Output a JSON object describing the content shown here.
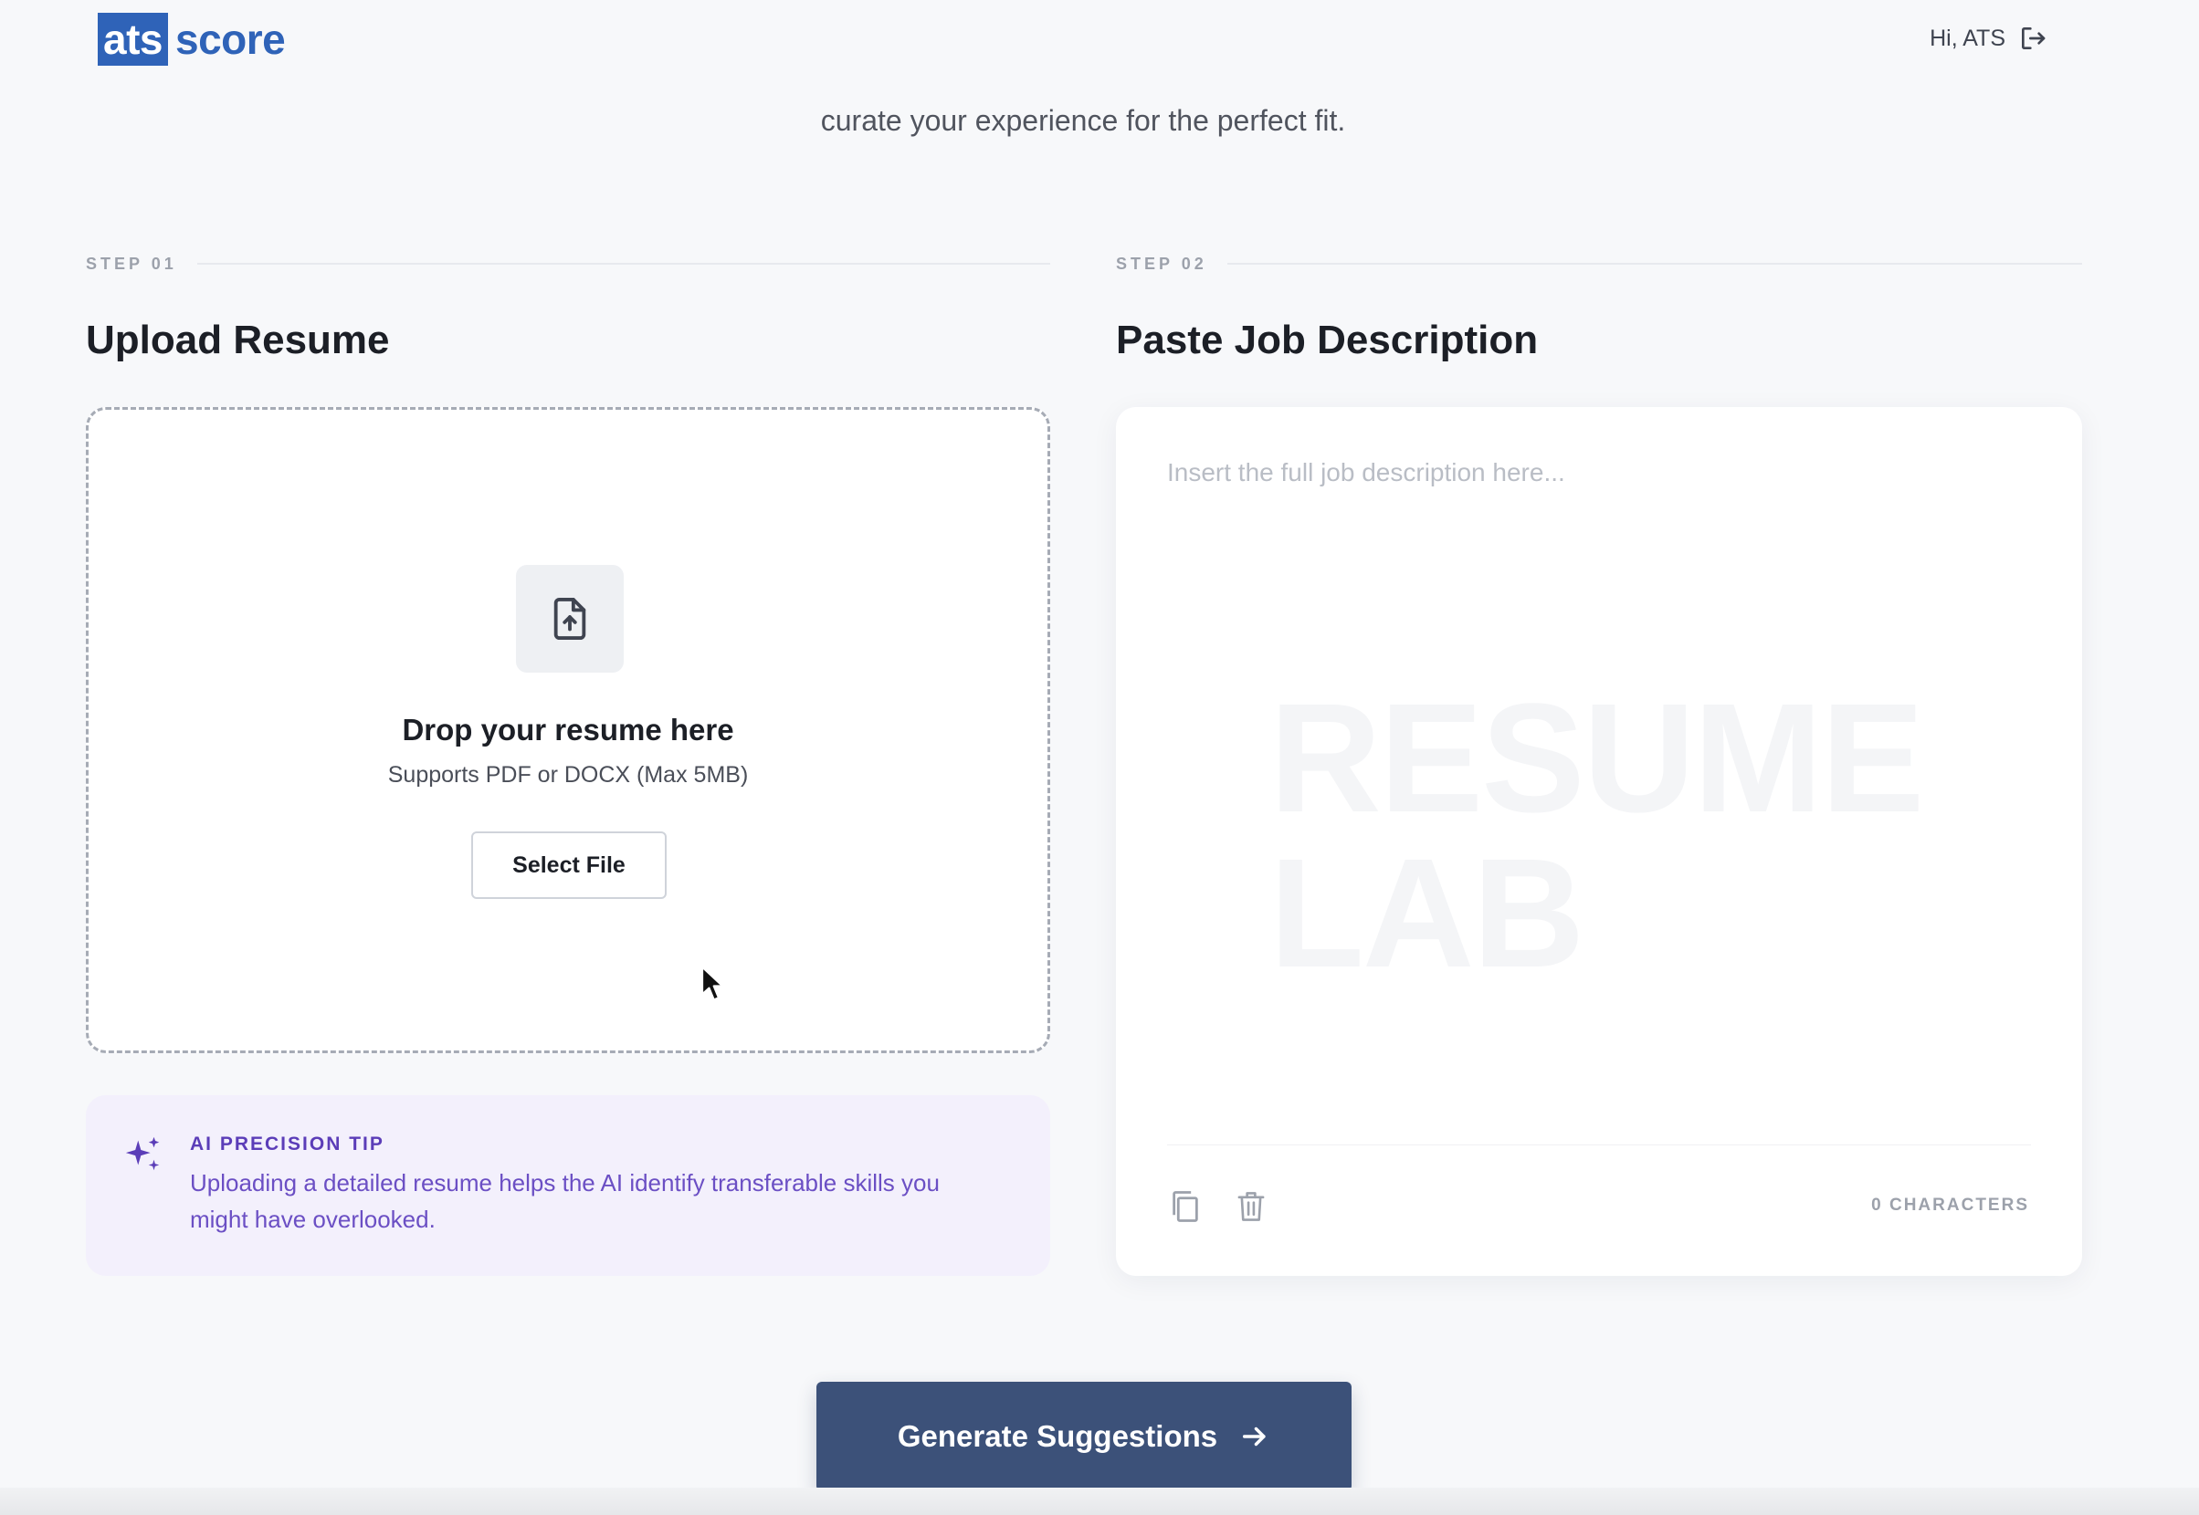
{
  "header": {
    "logo_ats": "ats",
    "logo_score": "score",
    "greeting": "Hi, ATS",
    "logout_icon": "logout-icon"
  },
  "subtitle": "curate your experience for the perfect fit.",
  "step1": {
    "label": "STEP 01",
    "title": "Upload Resume",
    "dropzone": {
      "icon": "file-upload-icon",
      "title": "Drop your resume here",
      "subtitle": "Supports PDF or DOCX (Max 5MB)",
      "button_label": "Select File"
    },
    "tip": {
      "icon": "sparkles-icon",
      "title": "AI PRECISION TIP",
      "text": "Uploading a detailed resume helps the AI identify transferable skills you might have overlooked."
    }
  },
  "step2": {
    "label": "STEP 02",
    "title": "Paste Job Description",
    "textarea_placeholder": "Insert the full job description here...",
    "textarea_value": "",
    "watermark": "RESUME\nLAB",
    "copy_icon": "copy-icon",
    "clear_icon": "trash-icon",
    "char_count": "0 CHARACTERS"
  },
  "generate_button": {
    "label": "Generate Suggestions",
    "icon": "arrow-right-icon"
  },
  "colors": {
    "brand": "#2f63b8",
    "primary_button": "#3c5179",
    "tip_accent": "#5b3db8",
    "background": "#f7f8fa"
  }
}
